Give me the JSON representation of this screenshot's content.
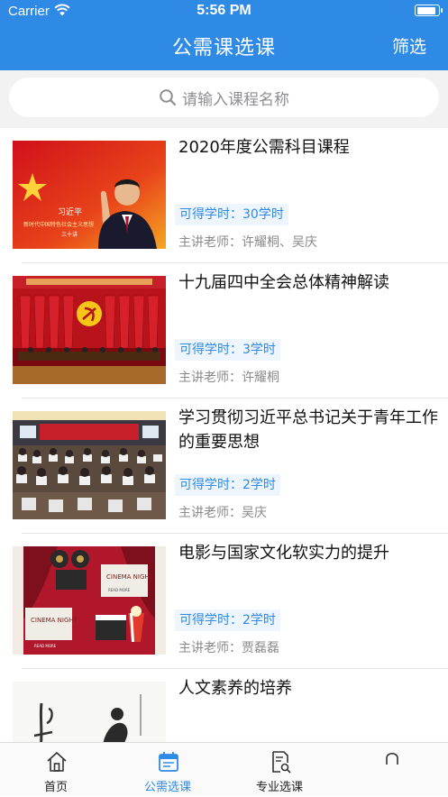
{
  "status_bar": {
    "carrier": "Carrier",
    "time": "5:56 PM",
    "battery_level": 0.9
  },
  "header": {
    "title": "公需课选课",
    "filter_label": "筛选"
  },
  "search": {
    "placeholder": "请输入课程名称"
  },
  "courses": [
    {
      "title": "2020年度公需科目课程",
      "hours": "可得学时：30学时",
      "teacher": "主讲老师：许耀桐、吴庆",
      "thumb_text": {
        "name": "习近平",
        "subtitle": "新时代中国特色社会主义思想",
        "sub2": "三十讲"
      }
    },
    {
      "title": "十九届四中全会总体精神解读",
      "hours": "可得学时：3学时",
      "teacher": "主讲老师：许耀桐"
    },
    {
      "title": "学习贯彻习近平总书记关于青年工作的重要思想",
      "hours": "可得学时：2学时",
      "teacher": "主讲老师：吴庆"
    },
    {
      "title": "电影与国家文化软实力的提升",
      "hours": "可得学时：2学时",
      "teacher": "主讲老师：贾磊磊",
      "thumb_text": {
        "sign_top": "CINEMA NIGHT",
        "sign_top_sub": "READ MORE",
        "sign_bottom": "CINEMA NIGHT",
        "sign_bottom_sub": "READ MORE"
      }
    },
    {
      "title": "人文素养的培养",
      "hours": "",
      "teacher": ""
    }
  ],
  "tabbar": {
    "tabs": [
      {
        "label": "首页",
        "icon": "home-icon"
      },
      {
        "label": "公需选课",
        "icon": "calendar-icon",
        "active": true
      },
      {
        "label": "专业选课",
        "icon": "document-search-icon"
      },
      {
        "label": "",
        "icon": "user-icon"
      }
    ]
  },
  "colors": {
    "primary": "#2f8ae6",
    "hours_bg": "#eef5fc"
  }
}
